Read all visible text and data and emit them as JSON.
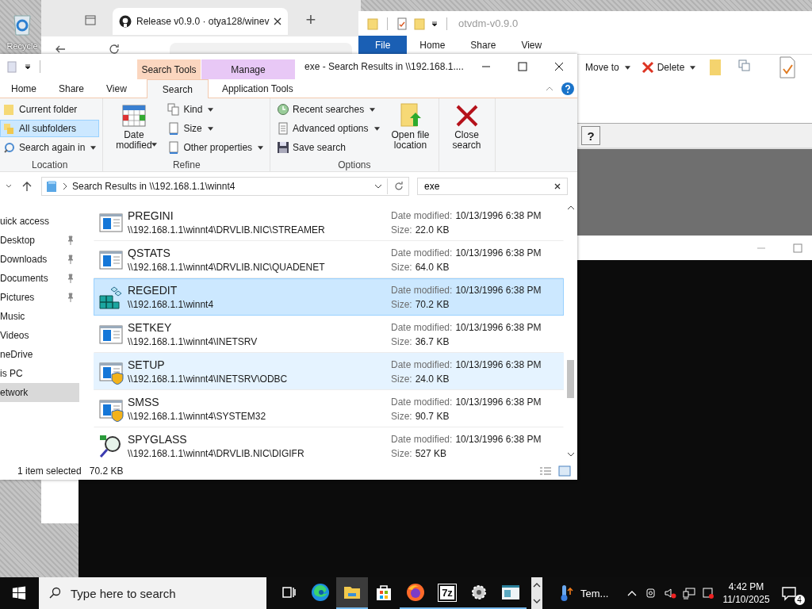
{
  "desktop": {
    "recycle_label": "Recycle"
  },
  "browser": {
    "tab_title": "Release v0.9.0 · otya128/winev",
    "new_tab": "+"
  },
  "back_explorer": {
    "title": "otvdm-v0.9.0",
    "tabs": [
      {
        "label": "File",
        "selected": true
      },
      {
        "label": "Home",
        "selected": false
      },
      {
        "label": "Share",
        "selected": false
      },
      {
        "label": "View",
        "selected": false
      }
    ],
    "ribbon": [
      "Move to",
      "Delete"
    ],
    "help": "?"
  },
  "explorer": {
    "title": "exe - Search Results in \\\\192.168.1....",
    "context_tabs": [
      {
        "label": "Search Tools",
        "color": "#fbd6bf"
      },
      {
        "label": "Manage",
        "color": "#e8c8f6"
      }
    ],
    "tabs": [
      {
        "label": "Home",
        "selected": false
      },
      {
        "label": "Share",
        "selected": false
      },
      {
        "label": "View",
        "selected": false
      },
      {
        "label": "Search",
        "selected": true
      },
      {
        "label": "Application Tools",
        "selected": false
      }
    ],
    "ribbon": {
      "groups": [
        {
          "label": "Location",
          "buttons": [
            {
              "label": "Current folder",
              "kind": "small",
              "selected": false,
              "dropdown": false
            },
            {
              "label": "All subfolders",
              "kind": "small",
              "selected": true,
              "dropdown": false
            },
            {
              "label": "Search again in",
              "kind": "small",
              "selected": false,
              "dropdown": true
            }
          ]
        },
        {
          "label": "Refine",
          "buttons": [
            {
              "label": "Date modified",
              "kind": "large",
              "selected": false,
              "dropdown": true
            },
            {
              "label": "Kind",
              "kind": "small",
              "selected": false,
              "dropdown": true
            },
            {
              "label": "Size",
              "kind": "small",
              "selected": false,
              "dropdown": true
            },
            {
              "label": "Other properties",
              "kind": "small",
              "selected": false,
              "dropdown": true
            }
          ]
        },
        {
          "label": "Options",
          "buttons": [
            {
              "label": "Recent searches",
              "kind": "small",
              "selected": false,
              "dropdown": true
            },
            {
              "label": "Advanced options",
              "kind": "small",
              "selected": false,
              "dropdown": true
            },
            {
              "label": "Save search",
              "kind": "small",
              "selected": false,
              "dropdown": false
            },
            {
              "label": "Open file location",
              "kind": "large",
              "selected": false,
              "dropdown": false
            }
          ]
        },
        {
          "buttons": [
            {
              "label": "Close search",
              "kind": "large",
              "selected": false,
              "dropdown": false
            }
          ]
        }
      ]
    },
    "address": "Search Results in \\\\192.168.1.1\\winnt4",
    "search": {
      "value": "exe"
    },
    "nav": [
      {
        "label": "uick access",
        "pinned": false,
        "selected": false
      },
      {
        "label": "Desktop",
        "pinned": true,
        "selected": false
      },
      {
        "label": "Downloads",
        "pinned": true,
        "selected": false
      },
      {
        "label": "Documents",
        "pinned": true,
        "selected": false
      },
      {
        "label": "Pictures",
        "pinned": true,
        "selected": false
      },
      {
        "label": "Music",
        "pinned": false,
        "selected": false
      },
      {
        "label": "Videos",
        "pinned": false,
        "selected": false
      },
      {
        "label": "neDrive",
        "pinned": false,
        "selected": false
      },
      {
        "label": "is PC",
        "pinned": false,
        "selected": false
      },
      {
        "label": "etwork",
        "pinned": false,
        "selected": true
      }
    ],
    "files": [
      {
        "name": "PREGINI",
        "path": "\\\\192.168.1.1\\winnt4\\DRVLIB.NIC\\STREAMER",
        "date_label": "Date modified:",
        "date": "10/13/1996 6:38 PM",
        "size_label": "Size:",
        "size": "22.0 KB",
        "kind": "program",
        "selected": false,
        "hovered": false
      },
      {
        "name": "QSTATS",
        "path": "\\\\192.168.1.1\\winnt4\\DRVLIB.NIC\\QUADENET",
        "date_label": "Date modified:",
        "date": "10/13/1996 6:38 PM",
        "size_label": "Size:",
        "size": "64.0 KB",
        "kind": "program",
        "selected": false,
        "hovered": false
      },
      {
        "name": "REGEDIT",
        "path": "\\\\192.168.1.1\\winnt4",
        "date_label": "Date modified:",
        "date": "10/13/1996 6:38 PM",
        "size_label": "Size:",
        "size": "70.2 KB",
        "kind": "registry",
        "selected": true,
        "hovered": false
      },
      {
        "name": "SETKEY",
        "path": "\\\\192.168.1.1\\winnt4\\INETSRV",
        "date_label": "Date modified:",
        "date": "10/13/1996 6:38 PM",
        "size_label": "Size:",
        "size": "36.7 KB",
        "kind": "program",
        "selected": false,
        "hovered": false
      },
      {
        "name": "SETUP",
        "path": "\\\\192.168.1.1\\winnt4\\INETSRV\\ODBC",
        "date_label": "Date modified:",
        "date": "10/13/1996 6:38 PM",
        "size_label": "Size:",
        "size": "24.0 KB",
        "kind": "shield",
        "selected": false,
        "hovered": true
      },
      {
        "name": "SMSS",
        "path": "\\\\192.168.1.1\\winnt4\\SYSTEM32",
        "date_label": "Date modified:",
        "date": "10/13/1996 6:38 PM",
        "size_label": "Size:",
        "size": "90.7 KB",
        "kind": "shield",
        "selected": false,
        "hovered": false
      },
      {
        "name": "SPYGLASS",
        "path": "\\\\192.168.1.1\\winnt4\\DRVLIB.NIC\\DIGIFR",
        "date_label": "Date modified:",
        "date": "10/13/1996 6:38 PM",
        "size_label": "Size:",
        "size": "527 KB",
        "kind": "magnifier",
        "selected": false,
        "hovered": false
      }
    ],
    "status": {
      "selection": "1 item selected",
      "size": "70.2 KB"
    }
  },
  "taskbar": {
    "search_placeholder": "Type here to search",
    "apps": [
      {
        "kind": "taskview",
        "running": false,
        "active": false
      },
      {
        "kind": "edge",
        "running": false,
        "active": false
      },
      {
        "kind": "explorer",
        "running": true,
        "active": true
      },
      {
        "kind": "store",
        "running": false,
        "active": false
      },
      {
        "kind": "firefox",
        "running": true,
        "active": false
      },
      {
        "kind": "sevenzip",
        "label": "7z",
        "running": true,
        "active": false
      },
      {
        "kind": "gear",
        "running": true,
        "active": false
      },
      {
        "kind": "window",
        "running": true,
        "active": false
      }
    ],
    "weather": "Tem...",
    "time": "4:42 PM",
    "date": "11/10/2025",
    "notifications": "4"
  }
}
